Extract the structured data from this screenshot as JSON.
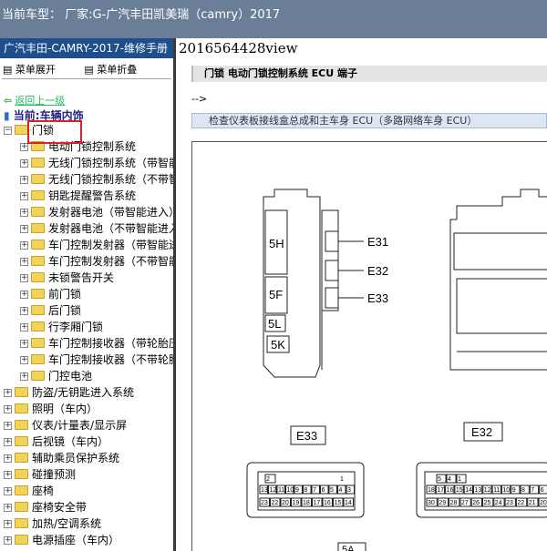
{
  "window": {
    "title": "当前车型：  厂家:G-广汽丰田凯美瑞（camry）2017"
  },
  "sidebar": {
    "manual_title": "广汽丰田-CAMRY-2017-维修手册",
    "expand_label": "菜单展开",
    "collapse_label": "菜单折叠",
    "back_label": "返回上一级",
    "current_label": "当前:车辆内饰",
    "tree": [
      {
        "label": "门锁",
        "level": 0,
        "expanded": true
      },
      {
        "label": "电动门锁控制系统",
        "level": 1
      },
      {
        "label": "无线门锁控制系统（带智能进入）",
        "level": 1
      },
      {
        "label": "无线门锁控制系统（不带智能进入）",
        "level": 1
      },
      {
        "label": "钥匙提醒警告系统",
        "level": 1
      },
      {
        "label": "发射器电池（带智能进入）",
        "level": 1
      },
      {
        "label": "发射器电池（不带智能进入）",
        "level": 1
      },
      {
        "label": "车门控制发射器（带智能进入）",
        "level": 1
      },
      {
        "label": "车门控制发射器（不带智能进入）",
        "level": 1
      },
      {
        "label": "未锁警告开关",
        "level": 1
      },
      {
        "label": "前门锁",
        "level": 1
      },
      {
        "label": "后门锁",
        "level": 1
      },
      {
        "label": "行李厢门锁",
        "level": 1
      },
      {
        "label": "车门控制接收器（带轮胎压力）",
        "level": 1
      },
      {
        "label": "车门控制接收器（不带轮胎压力）",
        "level": 1
      },
      {
        "label": "门控电池",
        "level": 1
      },
      {
        "label": "防盗/无钥匙进入系统",
        "level": 0
      },
      {
        "label": "照明（车内）",
        "level": 0
      },
      {
        "label": "仪表/计量表/显示屏",
        "level": 0
      },
      {
        "label": "后视镜（车内）",
        "level": 0
      },
      {
        "label": "辅助乘员保护系统",
        "level": 0
      },
      {
        "label": "碰撞预测",
        "level": 0
      },
      {
        "label": "座椅",
        "level": 0
      },
      {
        "label": "座椅安全带",
        "level": 0
      },
      {
        "label": "加热/空调系统",
        "level": 0
      },
      {
        "label": "电源插座（车内）",
        "level": 0
      }
    ]
  },
  "main": {
    "doc_id": "2016564428view",
    "section_header": "门锁  电动门锁控制系统  ECU 端子",
    "arrow_text": "-->",
    "subheader": "检查仪表板接线盒总成和主车身 ECU（多路网络车身 ECU）",
    "diagram": {
      "labels": [
        "5H",
        "5F",
        "5L",
        "5K",
        "E31",
        "E32",
        "E33",
        "E33",
        "E32",
        "5A"
      ],
      "pins_e33_top": [
        "2",
        "1"
      ],
      "pins_e33_mid": [
        "13",
        "12",
        "11",
        "10",
        "9",
        "8",
        "7",
        "6",
        "5",
        "4",
        "3"
      ],
      "pins_e33_bot": [
        "23",
        "22",
        "20",
        "19",
        "18",
        "17",
        "16",
        "15",
        "14"
      ],
      "pins_e32_top": [
        "5",
        "4",
        "1"
      ],
      "pins_e32_mid": [
        "18",
        "17",
        "16",
        "15",
        "14",
        "13",
        "12",
        "11",
        "10",
        "9",
        "8",
        "7",
        "6"
      ],
      "pins_e32_bot": [
        "30",
        "29",
        "28",
        "27",
        "26",
        "25",
        "24",
        "23",
        "22",
        "21",
        "20"
      ]
    }
  }
}
